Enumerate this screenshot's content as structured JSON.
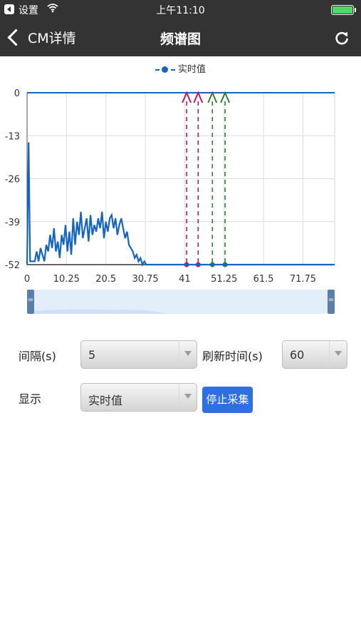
{
  "status_bar": {
    "app_label": "设置",
    "time": "上午11:10"
  },
  "nav": {
    "back_label": "CM详情",
    "title": "频谱图",
    "refresh_icon": "refresh-icon"
  },
  "chart_data": {
    "type": "line",
    "legend": [
      "实时值"
    ],
    "series": [
      {
        "name": "实时值",
        "color": "#1565c0",
        "x": [
          0,
          0.4,
          0.8,
          1.5,
          2,
          2.5,
          3,
          3.5,
          4,
          4.5,
          5,
          5.5,
          6,
          6.5,
          7,
          7.5,
          8,
          8.5,
          9,
          9.5,
          10,
          10.5,
          11,
          11.5,
          12,
          12.5,
          13,
          13.5,
          14,
          14.5,
          15,
          15.5,
          16,
          16.5,
          17,
          17.5,
          18,
          18.5,
          19,
          19.5,
          20,
          20.5,
          21,
          21.5,
          22,
          22.5,
          23,
          23.5,
          24,
          24.5,
          25,
          25.5,
          26,
          26.5,
          27,
          27.5,
          28,
          28.5,
          29,
          29.5,
          30,
          30.5,
          31,
          35,
          38,
          40,
          42,
          50,
          60,
          70,
          80
        ],
        "values": [
          -52,
          -15,
          -51,
          -51,
          -51,
          -48,
          -51,
          -47,
          -49,
          -51,
          -46,
          -48,
          -43,
          -47,
          -41,
          -48,
          -45,
          -50,
          -43,
          -46,
          -40,
          -48,
          -42,
          -49,
          -38,
          -46,
          -39,
          -43,
          -36,
          -44,
          -41,
          -38,
          -45,
          -37,
          -43,
          -40,
          -42,
          -38,
          -41,
          -36,
          -44,
          -39,
          -42,
          -38,
          -37,
          -41,
          -38,
          -43,
          -40,
          -38,
          -41,
          -44,
          -42,
          -46,
          -47,
          -48,
          -50,
          -49,
          -51,
          -50,
          -52,
          -51,
          -52,
          -52,
          -52,
          -52,
          -52,
          -52,
          -52,
          -52,
          -52
        ]
      }
    ],
    "x_ticks": [
      "0",
      "10.25",
      "20.5",
      "30.75",
      "41",
      "51.25",
      "61.5",
      "71.75"
    ],
    "y_ticks": [
      "0",
      "-13",
      "-26",
      "-39",
      "-52"
    ],
    "xlim": [
      0,
      80
    ],
    "ylim": [
      -52,
      0
    ],
    "grid": true,
    "markers": [
      {
        "x": 41.5,
        "color": "#c2185b"
      },
      {
        "x": 44.5,
        "color": "#c2185b"
      },
      {
        "x": 48.2,
        "color": "#2e7d32"
      },
      {
        "x": 51.5,
        "color": "#2e7d32"
      }
    ],
    "colors": {
      "line": "#1565c0",
      "grid": "#dddddd"
    }
  },
  "form": {
    "interval_label": "间隔(s)",
    "interval_value": "5",
    "refresh_label": "刷新时间(s)",
    "refresh_value": "60",
    "display_label": "显示",
    "display_value": "实时值",
    "stop_button": "停止采集"
  },
  "colors": {
    "nav_bg": "#333333",
    "accent": "#2f6fe0"
  }
}
